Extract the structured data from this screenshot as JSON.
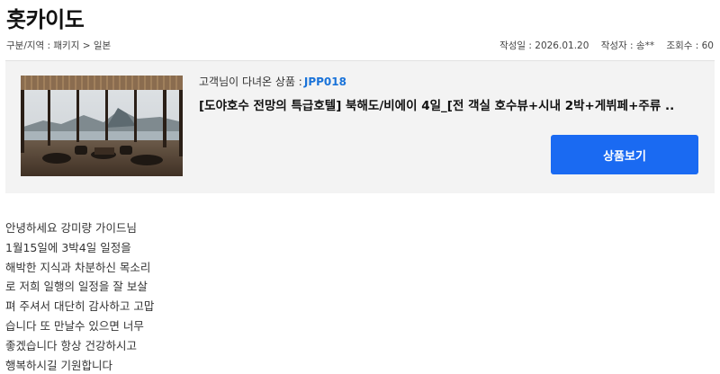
{
  "page": {
    "title": "홋카이도"
  },
  "meta": {
    "breadcrumb": "구분/지역 : 패키지 > 일본",
    "date": "작성일 : 2026.01.20",
    "author": "작성자 : 송**",
    "views": "조회수 : 60"
  },
  "product": {
    "visited_label": "고객님이 다녀온 상품 :",
    "code": "JPP018",
    "name": "[도야호수 전망의 특급호텔] 북해도/비에이 4일_[전 객실 호수뷰+시내 2박+게뷔페+주류 ..",
    "button_label": "상품보기",
    "thumbnail": "hotel-lobby-lake-view-image"
  },
  "review": {
    "lines": [
      "안녕하세요 강미량 가이드님",
      "1월15일에 3박4일 일정을",
      "해박한 지식과 차분하신 목소리",
      "로 저희 일행의 일정을 잘 보살",
      "펴 주셔서 대단히 감사하고 고맙",
      "습니다 또 만날수 있으면 너무",
      "좋겠습니다 항상 건강하시고",
      "행복하시길 기원합니다"
    ]
  },
  "colors": {
    "accent": "#1a6af2",
    "code": "#1a73d9",
    "panel": "#f3f3f3"
  }
}
